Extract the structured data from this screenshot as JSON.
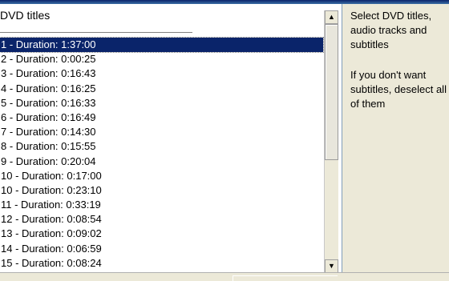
{
  "list": {
    "header": "DVD titles",
    "selected_index": 0,
    "rows": [
      "1 -  Duration: 1:37:00",
      "2 -  Duration: 0:00:25",
      "3 -  Duration: 0:16:43",
      "4 -  Duration: 0:16:25",
      "5 -  Duration: 0:16:33",
      "6 -  Duration: 0:16:49",
      "7 -  Duration: 0:14:30",
      "8 -  Duration: 0:15:55",
      "9 -  Duration: 0:20:04",
      "10 -  Duration: 0:17:00",
      "10 -  Duration: 0:23:10",
      "11 -  Duration: 0:33:19",
      "12 -  Duration: 0:08:54",
      "13 -  Duration: 0:09:02",
      "14 -  Duration: 0:06:59",
      "15 -  Duration: 0:08:24"
    ]
  },
  "scrollbar": {
    "up_glyph": "▲",
    "down_glyph": "▼"
  },
  "help": {
    "paragraph1": "Select DVD titles, audio tracks and subtitles",
    "paragraph2": "If you don't want subtitles, deselect all of them"
  },
  "colors": {
    "selection": "#0a246a",
    "panel_bg": "#ece9d8"
  }
}
